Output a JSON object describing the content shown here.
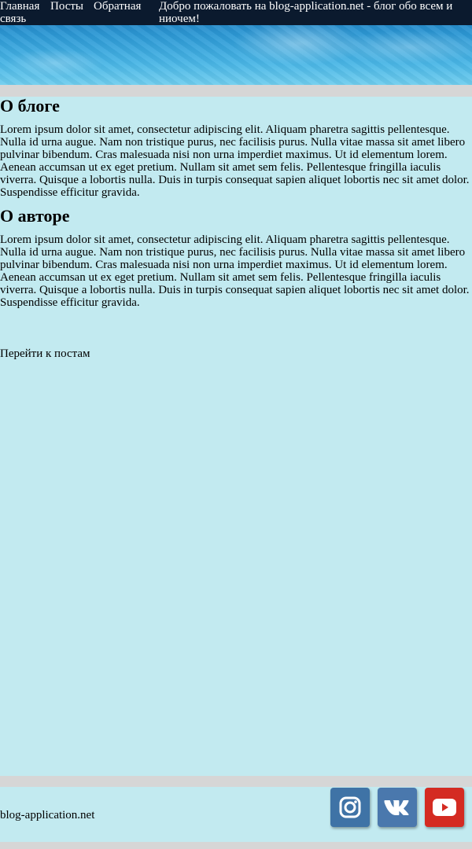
{
  "nav": {
    "home": "Главная",
    "posts": "Посты",
    "feedback_line1": "Обратная",
    "feedback_line2": "связь"
  },
  "header": {
    "welcome": "Добро пожаловать на blog-application.net - блог обо всем и ниочем!"
  },
  "main": {
    "about_blog": {
      "title": "О блоге",
      "text": "Lorem ipsum dolor sit amet, consectetur adipiscing elit. Aliquam pharetra sagittis pellentesque. Nulla id urna augue. Nam non tristique purus, nec facilisis purus. Nulla vitae massa sit amet libero pulvinar bibendum. Cras malesuada nisi non urna imperdiet maximus. Ut id elementum lorem. Aenean accumsan ut ex eget pretium. Nullam sit amet sem felis. Pellentesque fringilla iaculis viverra. Quisque a lobortis nulla. Duis in turpis consequat sapien aliquet lobortis nec sit amet dolor. Suspendisse efficitur gravida."
    },
    "about_author": {
      "title": "О авторе",
      "text": "Lorem ipsum dolor sit amet, consectetur adipiscing elit. Aliquam pharetra sagittis pellentesque. Nulla id urna augue. Nam non tristique purus, nec facilisis purus. Nulla vitae massa sit amet libero pulvinar bibendum. Cras malesuada nisi non urna imperdiet maximus. Ut id elementum lorem. Aenean accumsan ut ex eget pretium. Nullam sit amet sem felis. Pellentesque fringilla iaculis viverra. Quisque a lobortis nulla. Duis in turpis consequat sapien aliquet lobortis nec sit amet dolor. Suspendisse efficitur gravida."
    },
    "posts_link": "Перейти к постам"
  },
  "footer": {
    "site": "blog-application.net",
    "social": [
      {
        "icon": "instagram-icon",
        "color": "#3f73a6"
      },
      {
        "icon": "vk-icon",
        "color": "#4a78ad"
      },
      {
        "icon": "youtube-icon",
        "color": "#d42b22"
      }
    ]
  },
  "colors": {
    "page_background": "#c2eaf0",
    "topbar": "#0b1a2e",
    "separator": "#d6d6d6"
  }
}
